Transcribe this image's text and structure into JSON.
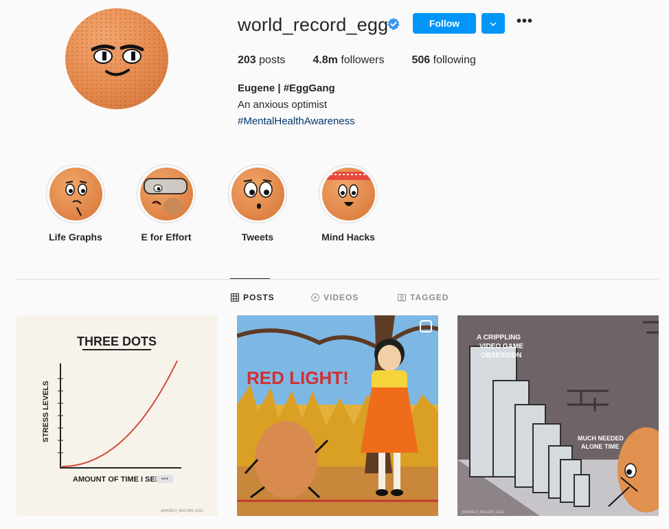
{
  "profile": {
    "username": "world_record_egg",
    "follow_label": "Follow",
    "stats": [
      {
        "value": "203",
        "label": "posts"
      },
      {
        "value": "4.8m",
        "label": "followers"
      },
      {
        "value": "506",
        "label": "following"
      }
    ],
    "bio_name": "Eugene | #EggGang",
    "bio_text": "An anxious optimist",
    "bio_tag": "#MentalHealthAwareness"
  },
  "highlights": [
    {
      "label": "Life Graphs"
    },
    {
      "label": "E for Effort"
    },
    {
      "label": "Tweets"
    },
    {
      "label": "Mind Hacks"
    }
  ],
  "tabs": [
    {
      "label": "POSTS",
      "icon": "grid-icon",
      "active": true
    },
    {
      "label": "VIDEOS",
      "icon": "play-icon",
      "active": false
    },
    {
      "label": "TAGGED",
      "icon": "tag-icon",
      "active": false
    }
  ],
  "posts": [
    {
      "title": "THREE DOTS",
      "y_label": "STRESS LEVELS",
      "x_label": "AMOUNT OF TIME I SEE",
      "watermark": "@WORLD_RECORD_EGG"
    },
    {
      "title": "RED LIGHT!"
    },
    {
      "caption_top_lines": [
        "A CRIPPLING",
        "VIDEO GAME",
        "OBSESSION"
      ],
      "caption_side_lines": [
        "MUCH NEEDED",
        "ALONE TIME"
      ],
      "watermark": "@WORLD_RECORD_EGG"
    }
  ],
  "colors": {
    "accent": "#0095f6",
    "link": "#00376b",
    "border": "#dbdbdb"
  }
}
